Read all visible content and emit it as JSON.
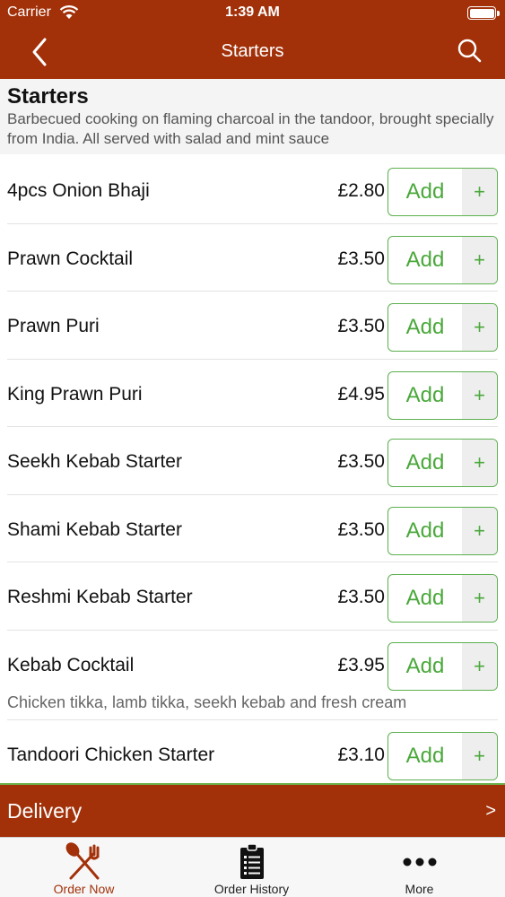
{
  "status_bar": {
    "carrier": "Carrier",
    "time": "1:39 AM"
  },
  "nav": {
    "title": "Starters",
    "back_icon": "chevron-left-icon",
    "search_icon": "search-icon"
  },
  "section": {
    "title": "Starters",
    "description": "Barbecued cooking on flaming charcoal in the tandoor, brought specially from India. All served with salad and mint sauce"
  },
  "add_label": "Add",
  "plus_label": "+",
  "items": [
    {
      "name": "4pcs Onion Bhaji",
      "price": "£2.80",
      "desc": ""
    },
    {
      "name": "Prawn Cocktail",
      "price": "£3.50",
      "desc": ""
    },
    {
      "name": "Prawn Puri",
      "price": "£3.50",
      "desc": ""
    },
    {
      "name": "King Prawn Puri",
      "price": "£4.95",
      "desc": ""
    },
    {
      "name": "Seekh Kebab Starter",
      "price": "£3.50",
      "desc": ""
    },
    {
      "name": "Shami Kebab Starter",
      "price": "£3.50",
      "desc": ""
    },
    {
      "name": "Reshmi Kebab Starter",
      "price": "£3.50",
      "desc": ""
    },
    {
      "name": "Kebab Cocktail",
      "price": "£3.95",
      "desc": "Chicken tikka, lamb tikka, seekh kebab and fresh cream"
    },
    {
      "name": "Tandoori Chicken Starter",
      "price": "£3.10",
      "desc": ""
    }
  ],
  "delivery": {
    "label": "Delivery",
    "chevron": ">"
  },
  "tabs": [
    {
      "label": "Order Now",
      "icon": "fork-knife-icon",
      "active": true
    },
    {
      "label": "Order History",
      "icon": "clipboard-list-icon",
      "active": false
    },
    {
      "label": "More",
      "icon": "more-dots-icon",
      "active": false
    }
  ],
  "colors": {
    "brand": "#a2310a",
    "accent_green": "#4aa83b"
  }
}
